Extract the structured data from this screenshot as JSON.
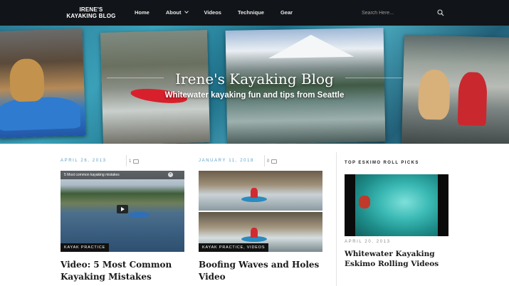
{
  "nav": {
    "logo_line1": "IRENE'S",
    "logo_line2": "KAYAKING BLOG",
    "items": [
      {
        "label": "Home"
      },
      {
        "label": "About",
        "has_dropdown": true
      },
      {
        "label": "Videos"
      },
      {
        "label": "Technique"
      },
      {
        "label": "Gear"
      }
    ],
    "search_placeholder": "Search Here..."
  },
  "hero": {
    "title": "Irene's Kayaking Blog",
    "subtitle": "Whitewater kayaking fun and tips from Seattle"
  },
  "posts": [
    {
      "date": "APRIL 26, 2013",
      "comments": "1",
      "video_title": "5 Most common kayaking mistakes",
      "category": "KAYAK PRACTICE",
      "title": "Video: 5 Most Common Kayaking Mistakes"
    },
    {
      "date": "JANUARY 11, 2018",
      "comments": "0",
      "category": "KAYAK PRACTICE, VIDEOS",
      "title": "Boofing Waves and Holes Video"
    }
  ],
  "sidebar": {
    "widget_title": "TOP ESKIMO ROLL PICKS",
    "post_date": "APRIL 20, 2013",
    "post_title": "Whitewater Kayaking Eskimo Rolling Videos"
  },
  "colors": {
    "nav_bg": "#111418",
    "date_accent": "#5ba0c8",
    "tag_bg": "#111111"
  }
}
